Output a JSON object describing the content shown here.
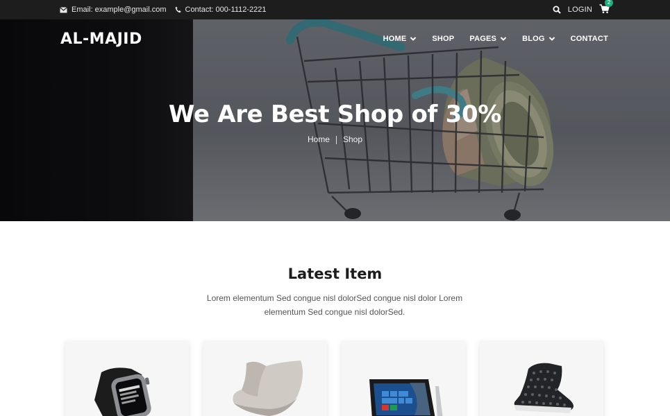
{
  "topbar": {
    "email": "Email: example@gmail.com",
    "contact": "Contact: 000-1112-2221",
    "login": "LOGIN",
    "cart_count": "2"
  },
  "header": {
    "logo": "AL-MAJID",
    "nav": [
      {
        "label": "HOME",
        "dropdown": true
      },
      {
        "label": "SHOP",
        "dropdown": false
      },
      {
        "label": "PAGES",
        "dropdown": true
      },
      {
        "label": "BLOG",
        "dropdown": true
      },
      {
        "label": "CONTACT",
        "dropdown": false
      }
    ]
  },
  "hero": {
    "title": "We Are Best Shop of 30%",
    "breadcrumb": [
      "Home",
      "Shop"
    ]
  },
  "latest": {
    "title": "Latest Item",
    "description": "Lorem elementum Sed congue nisl dolorSed congue nisl dolor Lorem elementum Sed congue nisl dolorSed."
  },
  "products": [
    {
      "icon": "smartwatch-icon"
    },
    {
      "icon": "egg-chair-icon"
    },
    {
      "icon": "laptop-icon"
    },
    {
      "icon": "studded-sneaker-icon"
    }
  ],
  "colors": {
    "topbar_bg": "#1d1d1d",
    "badge": "#1fae7e",
    "heading": "#1c1c1c"
  }
}
